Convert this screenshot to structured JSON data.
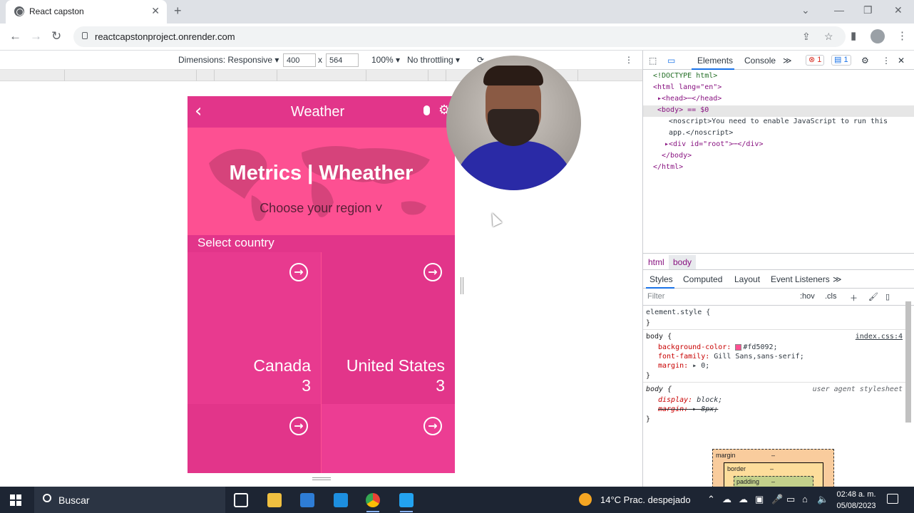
{
  "browser": {
    "tab_title": "React capston",
    "tab_close": "✕",
    "new_tab": "+",
    "url": "reactcapstonproject.onrender.com"
  },
  "device_toolbar": {
    "dimensions_label": "Dimensions: Responsive ▾",
    "width": "400",
    "times": "x",
    "height": "564",
    "zoom": "100% ▾",
    "throttling": "No throttling ▾"
  },
  "app": {
    "title": "Weather",
    "heading": "Metrics | Wheather",
    "region_selector": "Choose your region ˅",
    "section_label": "Select country",
    "colors": {
      "primary": "#fd5092",
      "bar": "#e2358a"
    },
    "countries": [
      {
        "name": "",
        "count": ""
      },
      {
        "name": "",
        "count": ""
      },
      {
        "name": "Canada",
        "count": "3"
      },
      {
        "name": "United States",
        "count": "3"
      },
      {
        "name": "",
        "count": ""
      },
      {
        "name": "",
        "count": ""
      }
    ]
  },
  "devtools": {
    "tabs": {
      "elements": "Elements",
      "console": "Console",
      "more": "≫"
    },
    "errors": "1",
    "messages": "1",
    "dom": {
      "doctype": "<!DOCTYPE html>",
      "html_open": "<html lang=\"en\">",
      "head": "▸<head>⋯</head>",
      "body": "<body> == $0",
      "noscript1": "<noscript>You need to enable JavaScript to run this",
      "noscript2": "app.</noscript>",
      "root_div": "▸<div id=\"root\">⋯</div>",
      "body_close": "</body>",
      "html_close": "</html>"
    },
    "breadcrumbs": [
      "html",
      "body"
    ],
    "style_tabs": {
      "styles": "Styles",
      "computed": "Computed",
      "layout": "Layout",
      "listeners": "Event Listeners",
      "more": "≫"
    },
    "filter_placeholder": "Filter",
    "hov": ":hov",
    "cls": ".cls",
    "rules": {
      "element_style": "element.style {",
      "close": "}",
      "body_sel": "body {",
      "src1": "index.css:4",
      "bg_prop": "background-color:",
      "bg_val": "#fd5092;",
      "ff_prop": "font-family:",
      "ff_val": "Gill Sans,sans-serif;",
      "margin_prop": "margin:",
      "margin_val": "▸ 0;",
      "body_sel2": "body {",
      "src2": "user agent stylesheet",
      "display_prop": "display:",
      "display_val": "block;",
      "margin2_prop": "margin:",
      "margin2_val": "▸ 8px;"
    },
    "boxmodel": {
      "margin": "margin",
      "border": "border",
      "padding": "padding",
      "dash": "–"
    }
  },
  "taskbar": {
    "search": "Buscar",
    "weather": "14°C  Prac. despejado",
    "time": "02:48 a. m.",
    "date": "05/08/2023"
  }
}
